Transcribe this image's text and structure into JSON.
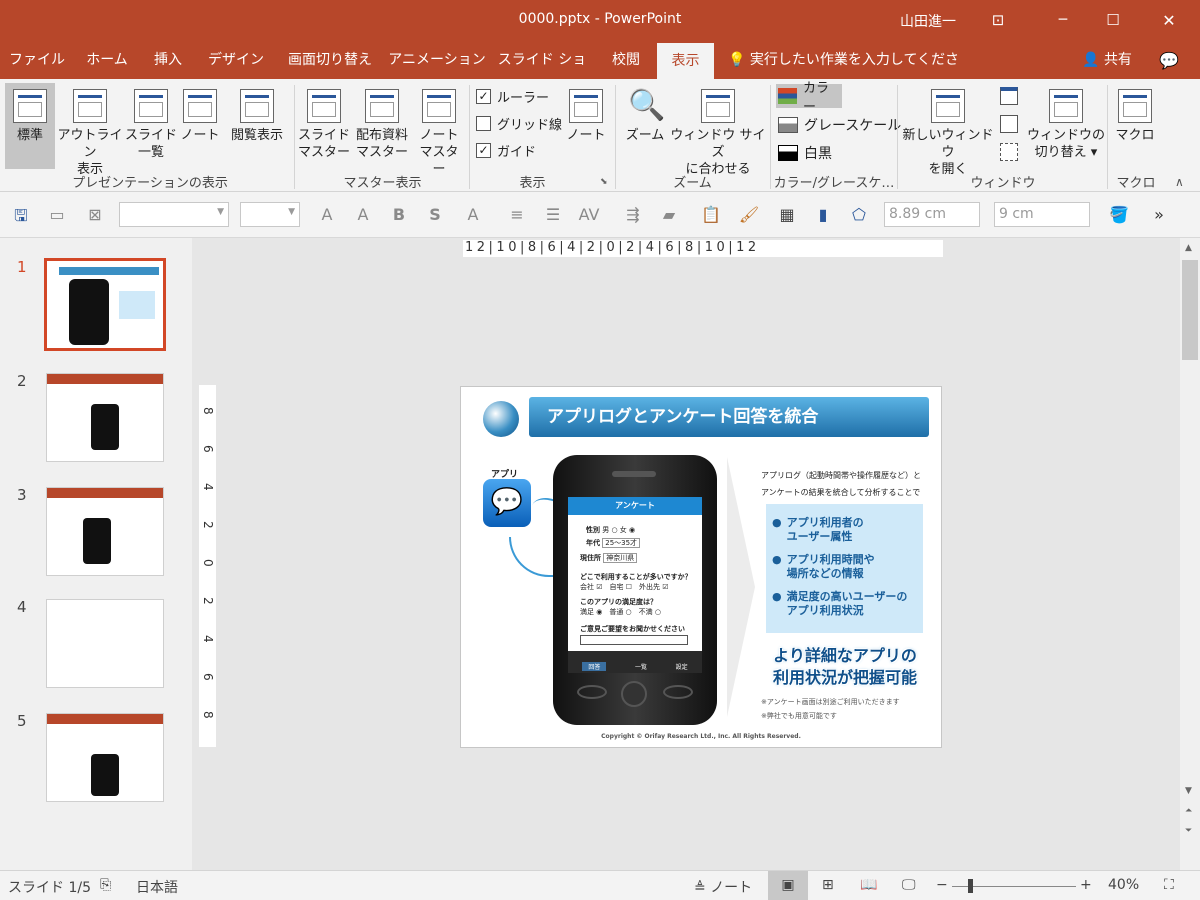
{
  "window": {
    "title": "0000.pptx  -  PowerPoint",
    "user": "山田進一",
    "minimize": "─",
    "maximize": "☐",
    "close": "✕"
  },
  "tabs": [
    "ファイル",
    "ホーム",
    "挿入",
    "デザイン",
    "画面切り替え",
    "アニメーション",
    "スライド ショー",
    "校閲",
    "表示"
  ],
  "active_tab": "表示",
  "tell_me": "実行したい作業を入力してください",
  "share": "共有",
  "ribbon": {
    "presentation_views": {
      "label": "プレゼンテーションの表示",
      "buttons": [
        "標準",
        "アウトライン\n表示",
        "スライド\n一覧",
        "ノート",
        "閲覧表示"
      ]
    },
    "master_views": {
      "label": "マスター表示",
      "buttons": [
        "スライド\nマスター",
        "配布資料\nマスター",
        "ノート\nマスター"
      ]
    },
    "show": {
      "label": "表示",
      "ruler": "ルーラー",
      "gridlines": "グリッド線",
      "guides": "ガイド",
      "notes": "ノート",
      "ruler_checked": true,
      "gridlines_checked": false,
      "guides_checked": true
    },
    "zoom": {
      "label": "ズーム",
      "zoom": "ズーム",
      "fit": "ウィンドウ サイズ\nに合わせる"
    },
    "color": {
      "label": "カラー/グレースケ…",
      "color": "カラー",
      "grayscale": "グレースケール",
      "bw": "白黒"
    },
    "window": {
      "label": "ウィンドウ",
      "new_window": "新しいウィンドウ\nを開く",
      "switch": "ウィンドウの\n切り替え ▾"
    },
    "macros": {
      "label": "マクロ",
      "macros": "マクロ"
    }
  },
  "qat": {
    "width_value": "8.89 cm",
    "height_value": "9 cm"
  },
  "ruler": {
    "horizontal": "12|10|8|6|4|2|0|2|4|6|8|10|12",
    "vertical": [
      "8",
      "6",
      "4",
      "2",
      "0",
      "2",
      "4",
      "6",
      "8"
    ]
  },
  "slides": [
    "1",
    "2",
    "3",
    "4",
    "5"
  ],
  "slide": {
    "title": "アプリログとアンケート回答を統合",
    "app_label": "アプリ",
    "survey_title": "アンケート",
    "gender_label": "性別",
    "gender_options": "男 ○ 女 ◉",
    "age_label": "年代",
    "age_value": "25～35才",
    "address_label": "現住所",
    "address_value": "神奈川県",
    "q1": "どこで利用することが多いですか？",
    "q1_options": "会社 ☑　自宅 ☐　外出先 ☑",
    "q2": "このアプリの満足度は？",
    "q2_options": "満足 ◉　普通 ○　不満 ○",
    "q3": "ご意見ご要望をお聞かせください",
    "nav": [
      "回答",
      "一覧",
      "設定"
    ],
    "desc": "アプリログ（起動時間帯や操作履歴など）と\nアンケートの結果を統合して分析することで",
    "bullets": [
      "アプリ利用者の\nユーザー属性",
      "アプリ利用時間や\n場所などの情報",
      "満足度の高いユーザーの\nアプリ利用状況"
    ],
    "headline": "より詳細なアプリの\n利用状況が把握可能",
    "notes": [
      "※アンケート画面は別途ご利用いただきます",
      "※弊社でも用意可能です"
    ],
    "copyright": "Copyright © Orifay Research Ltd., Inc. All Rights Reserved."
  },
  "status": {
    "slide": "スライド 1/5",
    "language": "日本語",
    "notes": "ノート",
    "zoom": "40%"
  }
}
